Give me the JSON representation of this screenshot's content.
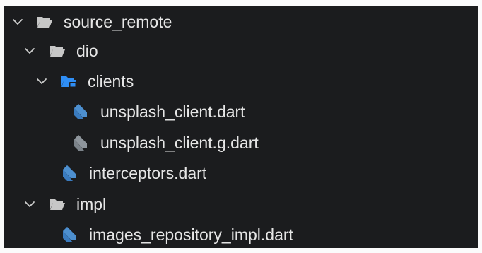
{
  "explorer": {
    "items": [
      {
        "label": "source_remote",
        "kind": "folder",
        "expanded": true
      },
      {
        "label": "dio",
        "kind": "folder",
        "expanded": true
      },
      {
        "label": "clients",
        "kind": "folder-special",
        "expanded": true
      },
      {
        "label": "unsplash_client.dart",
        "kind": "dart-file"
      },
      {
        "label": "unsplash_client.g.dart",
        "kind": "dart-generated-file"
      },
      {
        "label": "interceptors.dart",
        "kind": "dart-file"
      },
      {
        "label": "impl",
        "kind": "folder",
        "expanded": true
      },
      {
        "label": "images_repository_impl.dart",
        "kind": "dart-file"
      }
    ]
  },
  "colors": {
    "panel_background": "#1b1c1e",
    "text": "#e6e6e6",
    "folder": "#c7c7c7",
    "special_folder": "#2f8ef5",
    "dart_file": "#4d8fcf",
    "dart_generated_file": "#8e959c"
  }
}
